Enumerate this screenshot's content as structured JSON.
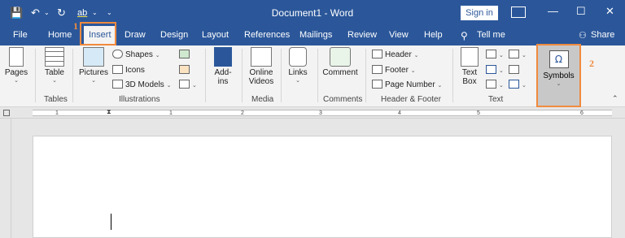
{
  "window": {
    "title": "Document1 - Word",
    "sign_in": "Sign in",
    "minimize_glyph": "—",
    "maximize_glyph": "☐",
    "close_glyph": "✕"
  },
  "qat": {
    "save": "💾",
    "undo": "↶",
    "redo": "↻",
    "format": "ab",
    "more": "⌄"
  },
  "tabs": [
    "File",
    "Home",
    "Insert",
    "Draw",
    "Design",
    "Layout",
    "References",
    "Mailings",
    "Review",
    "View",
    "Help",
    "Tell me",
    "Share"
  ],
  "annotations": {
    "one": "1",
    "two": "2",
    "color": "#f08a3e"
  },
  "ribbon": {
    "pages": "Pages",
    "table": "Table",
    "pictures": "Pictures",
    "shapes": "Shapes",
    "icons": "Icons",
    "models": "3D Models",
    "addins": "Add-",
    "addins2": "ins",
    "online": "Online",
    "videos": "Videos",
    "links": "Links",
    "comment": "Comment",
    "header": "Header",
    "footer": "Footer",
    "pagenum": "Page Number",
    "textbox": "Text",
    "textbox2": "Box",
    "symbols": "Symbols",
    "groups": [
      "Tables",
      "Illustrations",
      "Media",
      "Comments",
      "Header & Footer",
      "Text"
    ]
  },
  "ruler": {
    "ticks": [
      "1",
      "1",
      "2",
      "3",
      "4",
      "5",
      "6"
    ]
  },
  "colors": {
    "titlebar": "#2b579a",
    "ribbon": "#f3f3f3",
    "highlight": "#f08a3e"
  }
}
